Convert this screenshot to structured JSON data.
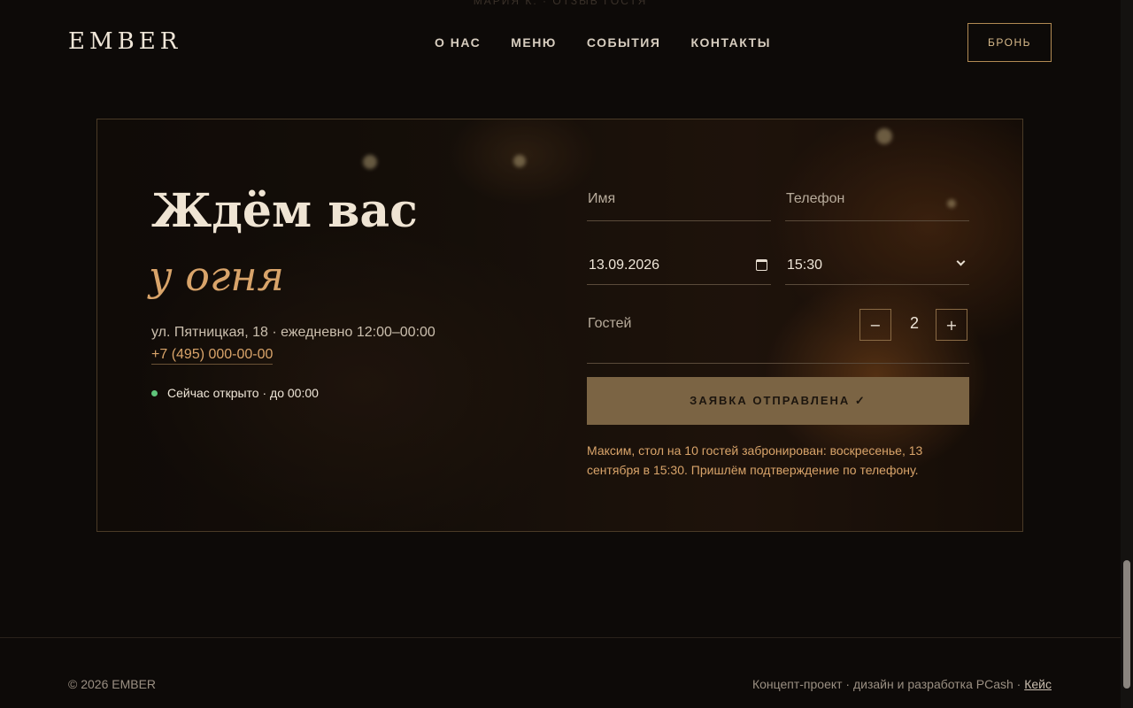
{
  "ghost_text": "МАРИЯ К. · ОТЗЫВ ГОСТЯ",
  "header": {
    "logo": "EMBER",
    "nav": [
      "О НАС",
      "МЕНЮ",
      "СОБЫТИЯ",
      "КОНТАКТЫ"
    ],
    "book_label": "БРОНЬ"
  },
  "hero": {
    "title": "Ждём вас",
    "title_accent": "у огня",
    "address": "ул. Пятницкая, 18 · ежедневно 12:00–00:00",
    "phone": "+7 (495) 000-00-00",
    "status": "Сейчас открыто · до 00:00",
    "status_color": "#5fc47a"
  },
  "form": {
    "name_placeholder": "Имя",
    "phone_placeholder": "Телефон",
    "date_value": "13.09.2026",
    "time_value": "15:30",
    "guests_label": "Гостей",
    "minus": "−",
    "plus": "+",
    "guests_count": "2",
    "submit_label": "ЗАЯВКА ОТПРАВЛЕНА ✓",
    "confirmation": "Максим, стол на 10 гостей забронирован: воскресенье, 13 сентября в 15:30. Пришлём подтверждение по телефону."
  },
  "footer": {
    "copyright": "© 2026 EMBER",
    "credits": "Концепт-проект · дизайн и разработка PCash · ",
    "case_link": "Кейс"
  },
  "colors": {
    "accent": "#d9a46a",
    "button": "#7b6444",
    "background": "#0d0a08"
  }
}
